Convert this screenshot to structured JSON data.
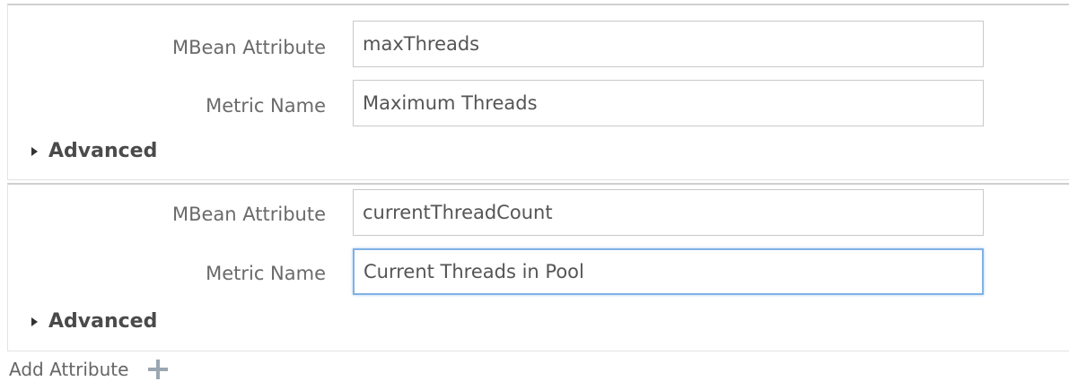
{
  "attributes": [
    {
      "mbean_label": "MBean Attribute",
      "mbean_value": "maxThreads",
      "metric_label": "Metric Name",
      "metric_value": "Maximum Threads",
      "advanced_label": "Advanced"
    },
    {
      "mbean_label": "MBean Attribute",
      "mbean_value": "currentThreadCount",
      "metric_label": "Metric Name",
      "metric_value": "Current Threads in Pool",
      "advanced_label": "Advanced"
    }
  ],
  "add_attribute_label": "Add Attribute",
  "icons": {
    "advanced": "caret-right-icon",
    "add": "plus-icon"
  },
  "colors": {
    "focus_border": "#7fb2e5",
    "add_icon": "#9aa7b3"
  }
}
